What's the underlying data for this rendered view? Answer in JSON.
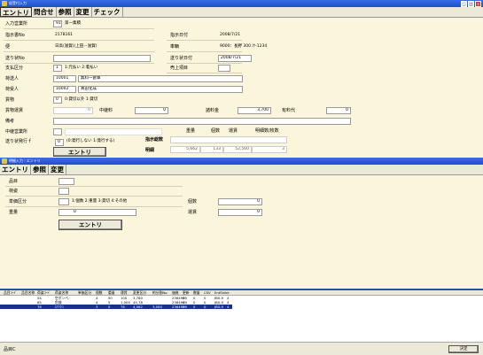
{
  "win1": {
    "title": "仮受付入力"
  },
  "toolbar1": [
    "エントリ",
    "問合せ",
    "参照",
    "変更",
    "チェック"
  ],
  "form1": {
    "labels": {
      "dept": "入力営業所",
      "order_no": "指示書No",
      "ship": "便",
      "delivery_no": "送り状No",
      "pay": "支払区分",
      "shipper": "荷送人",
      "consignee": "荷受人",
      "cargo": "貨物",
      "fare": "貨物運賃",
      "remarks": "備考",
      "transit": "中継営業所",
      "issue": "送り状発行ｆ",
      "order_date": "指示日付",
      "vehicle": "車輌",
      "send_date": "送り状日付",
      "sales": "売上項目",
      "relay_fee": "中継料",
      "fee": "諸料金",
      "toll": "有料代"
    },
    "values": {
      "dept_code": "91",
      "dept_name": "第一集積",
      "order_no": "2178161",
      "ship": "日高(滋賀)(上田－滋賀)",
      "pay_code": "1",
      "pay_hint": "1:元払い 2:着払い",
      "shipper_code": "10001",
      "shipper_name": "無料一倉庫",
      "consignee_code": "10002",
      "consignee_name": "真田化成",
      "cargo_code": "0",
      "cargo_hint": "0:貸切以外 1:貸切",
      "fare": "0",
      "relay_fee": "0",
      "fee": "3,700",
      "toll": "0",
      "issue_code": "0",
      "issue_hint": "(0:発行しない 1:発行する)",
      "order_date": "2008/7/21",
      "vehicle": "9000：長野 300 /ﾅ-1234",
      "send_date": "2008/7/21"
    },
    "summary": {
      "label": "指示総数",
      "detail": "明細",
      "headers": [
        "重量",
        "個数",
        "運賃",
        "明細数/枚数"
      ],
      "values": [
        "5,662",
        "133",
        "52,560",
        "3"
      ]
    },
    "entry_button": "エントリ"
  },
  "win2": {
    "title": "明細入力 : エントリ"
  },
  "toolbar2": [
    "エントリ",
    "参照",
    "変更"
  ],
  "form2": {
    "labels": {
      "item": "品目",
      "packing": "荷姿",
      "unit": "単価区分",
      "weight": "重量",
      "count": "個数",
      "fare": "運賃"
    },
    "unit_hint": "1:個数 2:重量 3:貸切 4:その他",
    "weight_value": "0",
    "count_value": "0",
    "fare_value": "0",
    "entry_button": "エントリ"
  },
  "grid": {
    "headers": [
      "品目ｺｰﾄﾞ",
      "品目名称",
      "荷姿ｺｰﾄﾞ",
      "荷姿名称",
      "単価区分",
      "個数",
      "重量",
      "運賃",
      "変更区分",
      "約分割No",
      "価格",
      "更新",
      "数量",
      "CSV",
      "EntShikir"
    ],
    "rows": [
      {
        "cells": [
          "",
          "",
          "54",
          "空ボンベ",
          "",
          "4",
          "50",
          "100",
          "3,780",
          "",
          "2364999",
          "0",
          "0",
          "0",
          "JB0-9",
          "4"
        ],
        "selected": false
      },
      {
        "cells": [
          "",
          "",
          "65",
          "危険",
          "",
          "4",
          "5",
          "1,000",
          "45,78",
          "",
          "2364999",
          "0",
          "0",
          "0",
          "JB0-9",
          "4"
        ],
        "selected": false
      },
      {
        "cells": [
          "",
          "",
          "76",
          "ｴｱｿｸｺ",
          "",
          "3",
          "0",
          "76",
          "4,562",
          "3,000",
          "2364999",
          "0",
          "0",
          "0",
          "JB0-9",
          "4"
        ],
        "selected": true
      }
    ]
  },
  "status": {
    "text": "品目C",
    "button": "決定"
  }
}
